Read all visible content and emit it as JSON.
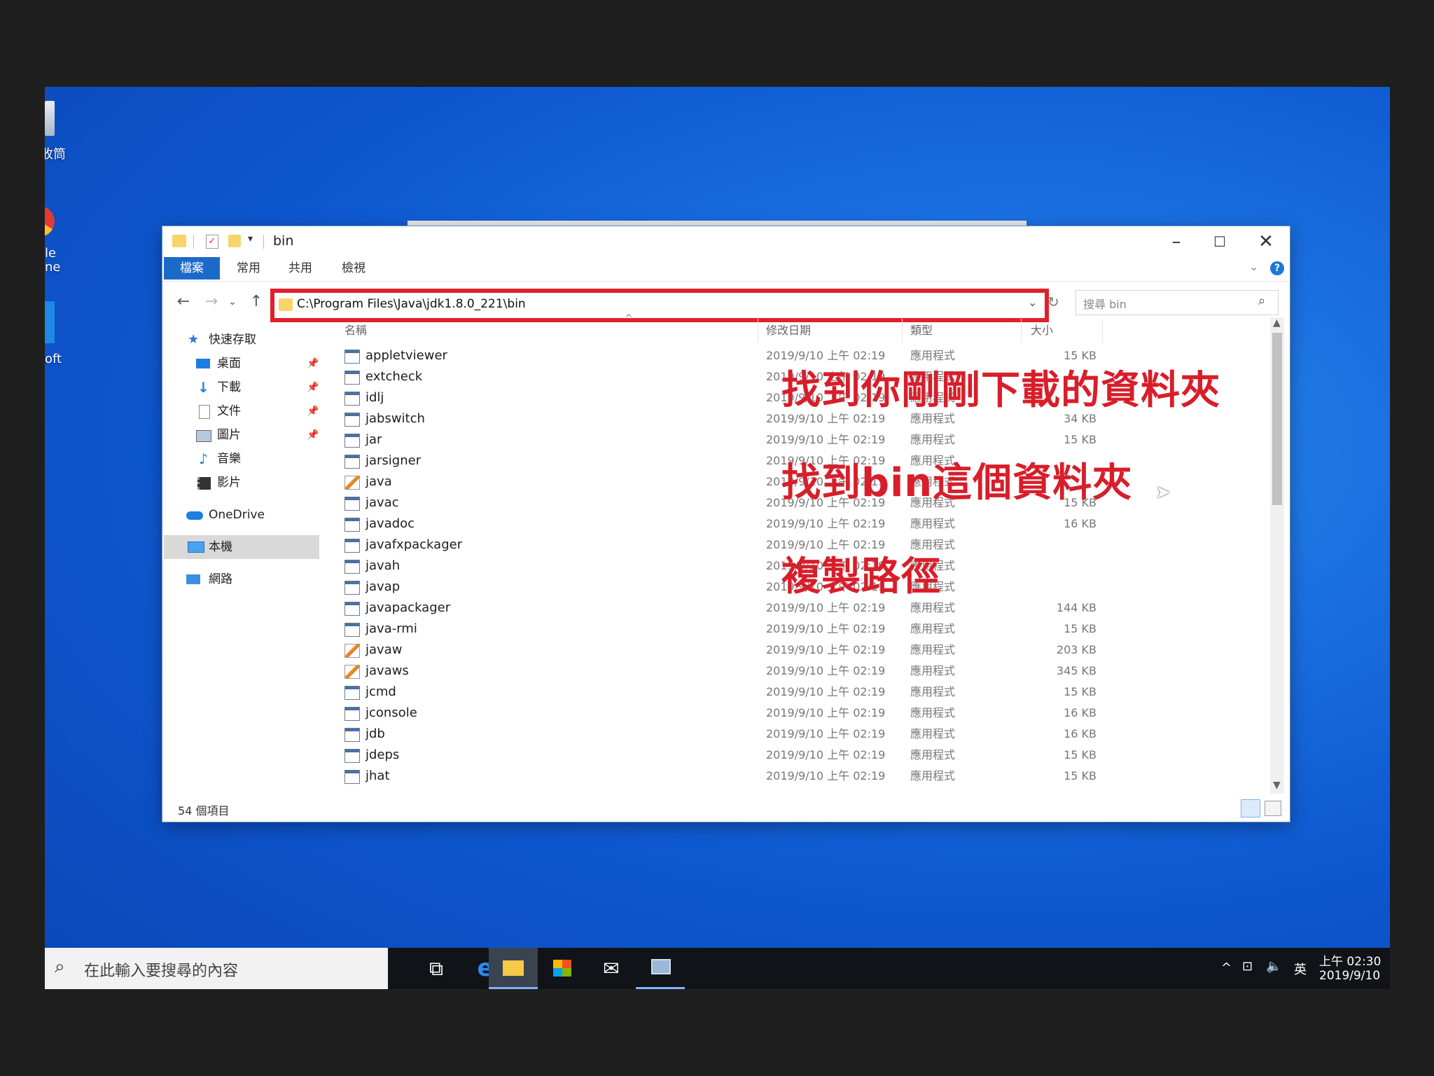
{
  "desktop": {
    "icons": [
      {
        "label": "收筒"
      },
      {
        "label": "le\nne"
      },
      {
        "label": "oft"
      }
    ]
  },
  "window": {
    "title": "bin",
    "ribbon_tabs": [
      {
        "label": "檔案"
      },
      {
        "label": "常用"
      },
      {
        "label": "共用"
      },
      {
        "label": "檢視"
      }
    ],
    "address": "C:\\Program Files\\Java\\jdk1.8.0_221\\bin",
    "search_placeholder": "搜尋 bin",
    "nav": [
      {
        "label": "快速存取",
        "icon": "star-icon"
      },
      {
        "label": "桌面",
        "icon": "desktop-icon"
      },
      {
        "label": "下載",
        "icon": "download-icon"
      },
      {
        "label": "文件",
        "icon": "document-icon"
      },
      {
        "label": "圖片",
        "icon": "picture-icon"
      },
      {
        "label": "音樂",
        "icon": "music-icon"
      },
      {
        "label": "影片",
        "icon": "video-icon"
      },
      {
        "label": "OneDrive",
        "icon": "cloud-icon"
      },
      {
        "label": "本機",
        "icon": "computer-icon"
      },
      {
        "label": "網路",
        "icon": "network-icon"
      }
    ],
    "columns": {
      "name": "名稱",
      "date": "修改日期",
      "type": "類型",
      "size": "大小"
    },
    "files": [
      {
        "name": "appletviewer",
        "date": "2019/9/10 上午 02:19",
        "type": "應用程式",
        "size": "15 KB",
        "java": false
      },
      {
        "name": "extcheck",
        "date": "2019/9/10 上午 02:19",
        "type": "應用程式",
        "size": "",
        "java": false
      },
      {
        "name": "idlj",
        "date": "2019/9/10 上午 02:19",
        "type": "應用程式",
        "size": "",
        "java": false
      },
      {
        "name": "jabswitch",
        "date": "2019/9/10 上午 02:19",
        "type": "應用程式",
        "size": "34 KB",
        "java": false
      },
      {
        "name": "jar",
        "date": "2019/9/10 上午 02:19",
        "type": "應用程式",
        "size": "15 KB",
        "java": false
      },
      {
        "name": "jarsigner",
        "date": "2019/9/10 上午 02:19",
        "type": "應用程式",
        "size": "",
        "java": false
      },
      {
        "name": "java",
        "date": "2019/9/10 上午 02:19",
        "type": "應用程式",
        "size": "",
        "java": true
      },
      {
        "name": "javac",
        "date": "2019/9/10 上午 02:19",
        "type": "應用程式",
        "size": "15 KB",
        "java": false
      },
      {
        "name": "javadoc",
        "date": "2019/9/10 上午 02:19",
        "type": "應用程式",
        "size": "16 KB",
        "java": false
      },
      {
        "name": "javafxpackager",
        "date": "2019/9/10 上午 02:19",
        "type": "應用程式",
        "size": "",
        "java": false
      },
      {
        "name": "javah",
        "date": "2019/9/10 上午 02:19",
        "type": "應用程式",
        "size": "",
        "java": false
      },
      {
        "name": "javap",
        "date": "2019/9/10 上午 02:19",
        "type": "應用程式",
        "size": "",
        "java": false
      },
      {
        "name": "javapackager",
        "date": "2019/9/10 上午 02:19",
        "type": "應用程式",
        "size": "144 KB",
        "java": false
      },
      {
        "name": "java-rmi",
        "date": "2019/9/10 上午 02:19",
        "type": "應用程式",
        "size": "15 KB",
        "java": false
      },
      {
        "name": "javaw",
        "date": "2019/9/10 上午 02:19",
        "type": "應用程式",
        "size": "203 KB",
        "java": true
      },
      {
        "name": "javaws",
        "date": "2019/9/10 上午 02:19",
        "type": "應用程式",
        "size": "345 KB",
        "java": true
      },
      {
        "name": "jcmd",
        "date": "2019/9/10 上午 02:19",
        "type": "應用程式",
        "size": "15 KB",
        "java": false
      },
      {
        "name": "jconsole",
        "date": "2019/9/10 上午 02:19",
        "type": "應用程式",
        "size": "16 KB",
        "java": false
      },
      {
        "name": "jdb",
        "date": "2019/9/10 上午 02:19",
        "type": "應用程式",
        "size": "16 KB",
        "java": false
      },
      {
        "name": "jdeps",
        "date": "2019/9/10 上午 02:19",
        "type": "應用程式",
        "size": "15 KB",
        "java": false
      },
      {
        "name": "jhat",
        "date": "2019/9/10 上午 02:19",
        "type": "應用程式",
        "size": "15 KB",
        "java": false
      }
    ],
    "status": "54 個項目"
  },
  "annotations": [
    {
      "text": "找到你剛剛下載的資料夾"
    },
    {
      "text": "找到bin這個資料夾"
    },
    {
      "text": "複製路徑"
    }
  ],
  "taskbar": {
    "search_placeholder": "在此輸入要搜尋的內容",
    "apps": [
      "task-view-icon",
      "edge-icon",
      "file-explorer-icon",
      "store-icon",
      "mail-icon",
      "network-tool-icon"
    ],
    "tray_lang": "英",
    "time": "上午 02:30",
    "date": "2019/9/10"
  },
  "colors": {
    "accent": "#1b6ac9",
    "annotation": "#d81e2a",
    "highlight_box": "#e0202a"
  }
}
